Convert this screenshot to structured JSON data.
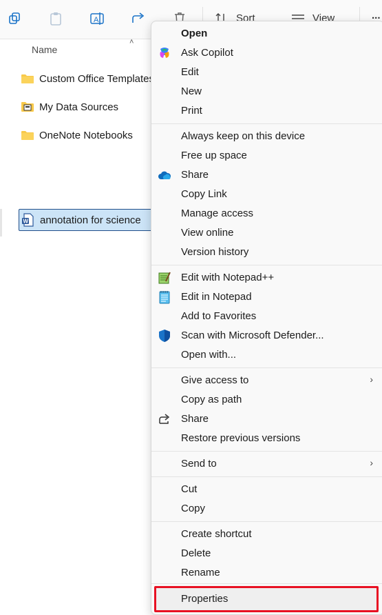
{
  "toolbar": {
    "sort_label": "Sort",
    "view_label": "View",
    "more_label": "..."
  },
  "file_list": {
    "column_name": "Name",
    "items": [
      {
        "name": "Custom Office Templates",
        "icon": "folder-icon"
      },
      {
        "name": "My Data Sources",
        "icon": "data-sources-folder-icon"
      },
      {
        "name": "OneNote Notebooks",
        "icon": "folder-icon"
      },
      {
        "name": "annotation for science",
        "icon": "word-document-icon"
      }
    ]
  },
  "context_menu": {
    "group1": [
      "Open",
      "Ask Copilot",
      "Edit",
      "New",
      "Print"
    ],
    "group2": [
      "Always keep on this device",
      "Free up space",
      "Share",
      "Copy Link",
      "Manage access",
      "View online",
      "Version history"
    ],
    "group3": [
      "Edit with Notepad++",
      "Edit in Notepad",
      "Add to Favorites",
      "Scan with Microsoft Defender...",
      "Open with..."
    ],
    "group4": [
      "Give access to",
      "Copy as path",
      "Share",
      "Restore previous versions"
    ],
    "group5": [
      "Send to"
    ],
    "group6": [
      "Cut",
      "Copy"
    ],
    "group7": [
      "Create shortcut",
      "Delete",
      "Rename"
    ],
    "group8": [
      "Properties"
    ]
  },
  "colors": {
    "highlight_border": "#e81123",
    "selection_fill": "#cce4f7",
    "accent": "#0078d4"
  }
}
